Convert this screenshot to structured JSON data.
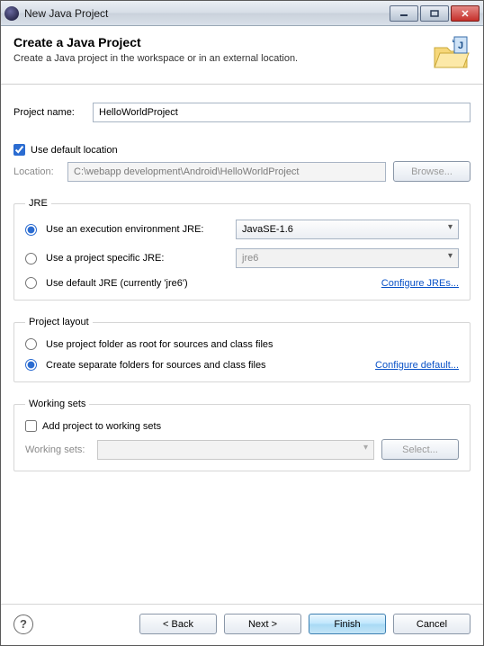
{
  "window": {
    "title": "New Java Project"
  },
  "banner": {
    "heading": "Create a Java Project",
    "description": "Create a Java project in the workspace or in an external location."
  },
  "projectName": {
    "label": "Project name:",
    "value": "HelloWorldProject"
  },
  "defaultLocation": {
    "label": "Use default location",
    "checked": true
  },
  "location": {
    "label": "Location:",
    "value": "C:\\webapp development\\Android\\HelloWorldProject",
    "browse": "Browse..."
  },
  "jre": {
    "legend": "JRE",
    "opt1": {
      "label": "Use an execution environment JRE:",
      "value": "JavaSE-1.6"
    },
    "opt2": {
      "label": "Use a project specific JRE:",
      "value": "jre6"
    },
    "opt3": {
      "label": "Use default JRE (currently 'jre6')"
    },
    "configure": "Configure JREs..."
  },
  "projectLayout": {
    "legend": "Project layout",
    "opt1": "Use project folder as root for sources and class files",
    "opt2": "Create separate folders for sources and class files",
    "configure": "Configure default..."
  },
  "workingSets": {
    "legend": "Working sets",
    "addLabel": "Add project to working sets",
    "label": "Working sets:",
    "select": "Select..."
  },
  "buttons": {
    "back": "< Back",
    "next": "Next >",
    "finish": "Finish",
    "cancel": "Cancel"
  }
}
